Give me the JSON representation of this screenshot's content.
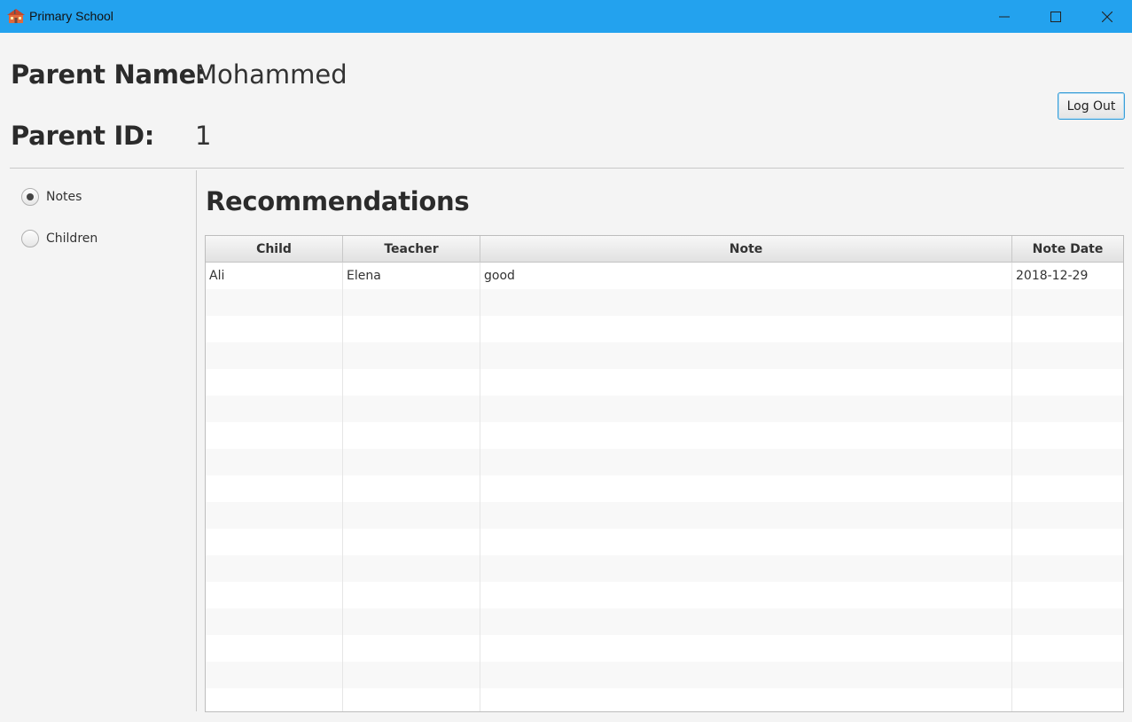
{
  "window": {
    "title": "Primary School",
    "icon": "school-icon",
    "controls": [
      "minimize-icon",
      "maximize-icon",
      "close-icon"
    ]
  },
  "header": {
    "parent_name_label": "Parent Name:",
    "parent_name_value": "Mohammed",
    "parent_id_label": "Parent ID:",
    "parent_id_value": "1",
    "logout_label": "Log Out"
  },
  "sidebar": {
    "options": [
      {
        "label": "Notes",
        "selected": true
      },
      {
        "label": "Children",
        "selected": false
      }
    ]
  },
  "main": {
    "title": "Recommendations",
    "table": {
      "columns": [
        "Child",
        "Teacher",
        "Note",
        "Note Date"
      ],
      "rows": [
        [
          "Ali",
          "Elena",
          "good",
          "2018-12-29"
        ]
      ]
    }
  },
  "colors": {
    "titlebar": "#23a2ee",
    "background": "#f4f4f4",
    "focus_border": "#3a9fd8"
  }
}
